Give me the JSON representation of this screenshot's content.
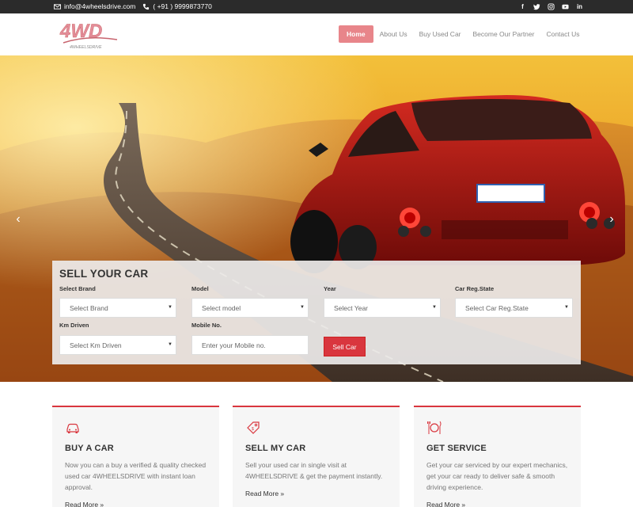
{
  "topbar": {
    "email": "info@4wheelsdrive.com",
    "phone": "( +91 ) 9999873770",
    "social": [
      "facebook-icon",
      "twitter-icon",
      "instagram-icon",
      "youtube-icon",
      "linkedin-icon"
    ]
  },
  "brand": {
    "logo_main": "4WD",
    "logo_sub": "4WHEELSDRIVE"
  },
  "nav": {
    "items": [
      {
        "label": "Home",
        "active": true
      },
      {
        "label": "About Us"
      },
      {
        "label": "Buy Used Car"
      },
      {
        "label": "Become Our Partner"
      },
      {
        "label": "Contact Us"
      }
    ]
  },
  "hero": {
    "prev_arrow": "‹",
    "next_arrow": "›"
  },
  "sell_form": {
    "title": "SELL YOUR CAR",
    "fields": {
      "brand": {
        "label": "Select Brand",
        "value": "Select Brand"
      },
      "model": {
        "label": "Model",
        "value": "Select model"
      },
      "year": {
        "label": "Year",
        "value": "Select Year"
      },
      "state": {
        "label": "Car Reg.State",
        "value": "Select Car Reg.State"
      },
      "km": {
        "label": "Km Driven",
        "value": "Select Km Driven"
      },
      "mobile": {
        "label": "Mobile No.",
        "placeholder": "Enter your Mobile no."
      }
    },
    "submit_label": "Sell Car"
  },
  "cards": [
    {
      "icon": "car-icon",
      "title": "BUY A CAR",
      "text": "Now you can a buy a verified & quality checked used car 4WHEELSDRIVE with instant loan approval.",
      "more": "Read More  »"
    },
    {
      "icon": "price-tag-icon",
      "title": "SELL MY CAR",
      "text": "Sell your used car in single visit at 4WHEELSDRIVE & get the payment instantly.",
      "more": "Read More  »"
    },
    {
      "icon": "service-tools-icon",
      "title": "GET SERVICE",
      "text": "Get your car serviced by our expert mechanics, get your car ready to deliver safe & smooth driving experience.",
      "more": "Read More  »"
    }
  ],
  "colors": {
    "accent": "#d9363e",
    "nav_active": "#e8858a",
    "topbar": "#2b2b2b"
  }
}
